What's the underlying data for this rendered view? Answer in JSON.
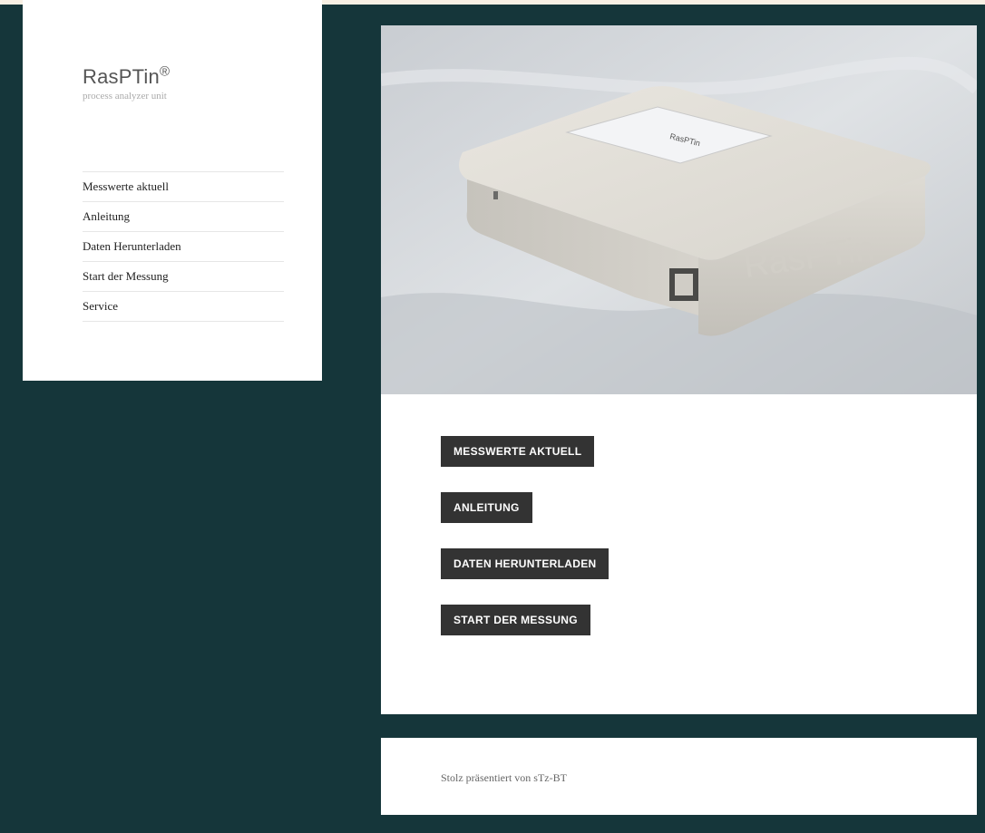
{
  "site": {
    "title": "RasPTin",
    "registered_mark": "®",
    "subtitle": "process analyzer unit"
  },
  "sidebar": {
    "items": [
      {
        "label": "Messwerte aktuell"
      },
      {
        "label": "Anleitung"
      },
      {
        "label": "Daten Herunterladen"
      },
      {
        "label": "Start der Messung"
      },
      {
        "label": "Service"
      }
    ]
  },
  "hero": {
    "device_label": "RasPTin"
  },
  "main": {
    "buttons": [
      {
        "label": "MESSWERTE AKTUELL"
      },
      {
        "label": "ANLEITUNG"
      },
      {
        "label": "DATEN HERUNTERLADEN"
      },
      {
        "label": "START DER MESSUNG"
      }
    ]
  },
  "footer": {
    "text": "Stolz präsentiert von sTz-BT"
  },
  "colors": {
    "background": "#15363a",
    "panel": "#ffffff",
    "button": "#333333",
    "button_text": "#ffffff"
  }
}
